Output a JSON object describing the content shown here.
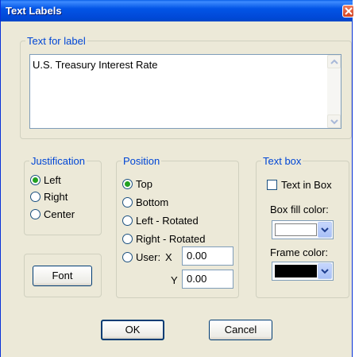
{
  "window": {
    "title": "Text Labels"
  },
  "text_for_label": {
    "legend": "Text for label",
    "value": "U.S. Treasury Interest Rate"
  },
  "justification": {
    "legend": "Justification",
    "options": [
      "Left",
      "Right",
      "Center"
    ],
    "selected": "Left"
  },
  "position": {
    "legend": "Position",
    "options": [
      "Top",
      "Bottom",
      "Left - Rotated",
      "Right - Rotated",
      "User:"
    ],
    "selected": "Top",
    "x_label": "X",
    "y_label": "Y",
    "x_value": "0.00",
    "y_value": "0.00"
  },
  "text_box": {
    "legend": "Text box",
    "checkbox_label": "Text in Box",
    "checked": false,
    "fill_color_label": "Box fill color:",
    "fill_color": "#FFFFFF",
    "frame_color_label": "Frame color:",
    "frame_color": "#000000"
  },
  "buttons": {
    "font": "Font",
    "ok": "OK",
    "cancel": "Cancel"
  },
  "theme": {
    "titlebar": "#0054E3",
    "accent_legend": "#0046D5",
    "radio_selected": "#21A121"
  }
}
